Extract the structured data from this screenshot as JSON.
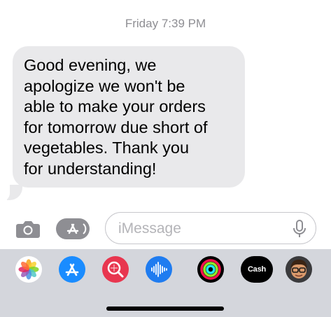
{
  "thread": {
    "timestamp": "Friday 7:39 PM",
    "messages": [
      {
        "direction": "incoming",
        "text": "Good evening, we\napologize we won't be\nable to make your orders\nfor tomorrow due short of\nvegetables. Thank you\nfor understanding!"
      }
    ]
  },
  "composer": {
    "placeholder": "iMessage",
    "value": "",
    "camera_icon": "camera-icon",
    "apps_icon": "app-store-icon",
    "mic_icon": "microphone-icon"
  },
  "app_tray": {
    "apps": [
      {
        "name": "Photos",
        "icon": "photos-icon"
      },
      {
        "name": "App Store",
        "icon": "app-store-icon"
      },
      {
        "name": "Images",
        "icon": "image-search-icon"
      },
      {
        "name": "Audio",
        "icon": "audio-waveform-icon"
      },
      {
        "name": "Activity",
        "icon": "activity-rings-icon"
      },
      {
        "name": "Apple Cash",
        "icon": "apple-cash-icon",
        "label": "Cash"
      },
      {
        "name": "Memoji",
        "icon": "memoji-icon"
      }
    ]
  },
  "colors": {
    "incoming_bubble": "#e9e9eb",
    "timestamp": "#8e8e93",
    "tray_background": "#d4d6dc",
    "app_store_blue": "#1a8cff",
    "image_search_red": "#e8364f",
    "audio_blue": "#1f7cf0"
  }
}
